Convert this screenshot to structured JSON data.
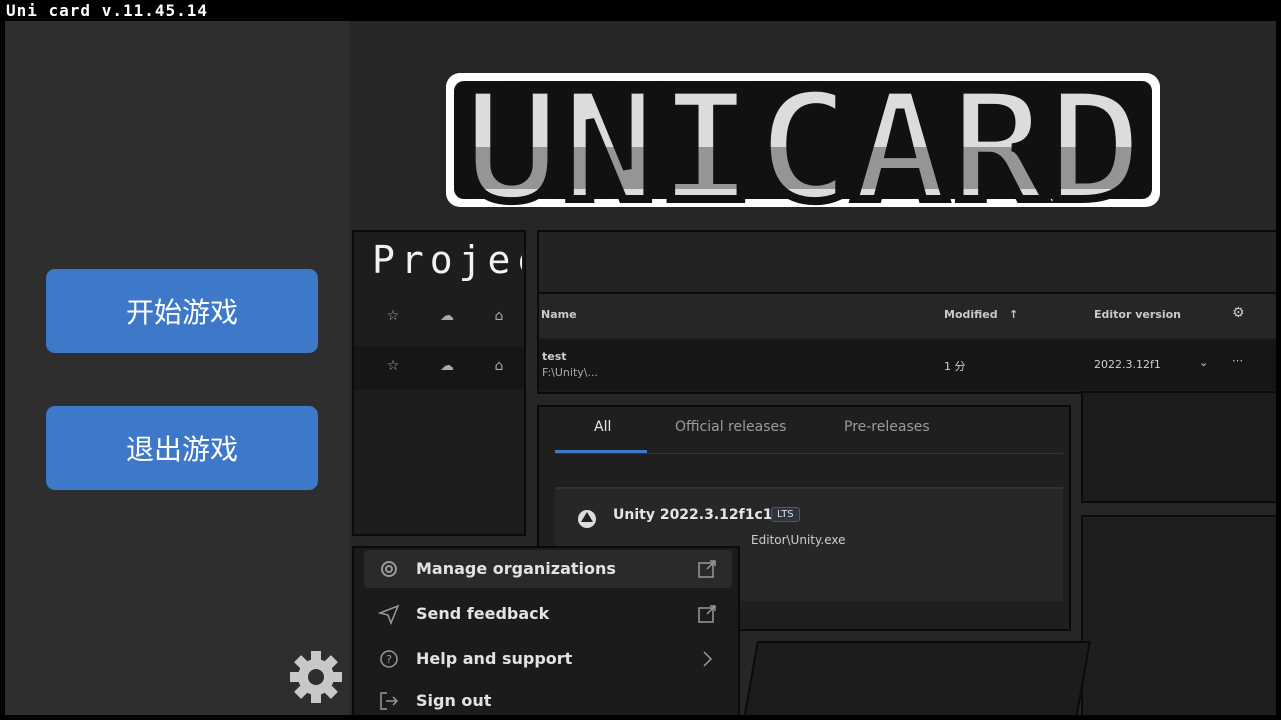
{
  "window": {
    "title": "Uni card v.11.45.14"
  },
  "menu": {
    "start_label": "开始游戏",
    "exit_label": "退出游戏"
  },
  "logo": {
    "text": "UNICARD"
  },
  "projects": {
    "title": "Projec",
    "columns": {
      "name": "Name",
      "modified": "Modified",
      "editor": "Editor version"
    },
    "row": {
      "name": "test",
      "path": "F:\\Unity\\...",
      "modified": "1 分",
      "editor": "2022.3.12f1"
    }
  },
  "installs": {
    "tabs": [
      "All",
      "Official releases",
      "Pre-releases"
    ],
    "unity_version": "Unity 2022.3.12f1c1",
    "badge": "LTS",
    "path": "Editor\\Unity.exe"
  },
  "context_menu": {
    "items": [
      {
        "label": "Manage organizations",
        "icon": "gear-icon",
        "trail": "external-link-icon"
      },
      {
        "label": "Send feedback",
        "icon": "send-icon",
        "trail": "external-link-icon"
      },
      {
        "label": "Help and support",
        "icon": "help-icon",
        "trail": "chevron-right-icon"
      },
      {
        "label": "Sign out",
        "icon": "sign-out-icon",
        "trail": ""
      }
    ]
  },
  "colors": {
    "button": "#3d78c9",
    "left_panel": "#2e2e2e",
    "background": "#262626"
  }
}
